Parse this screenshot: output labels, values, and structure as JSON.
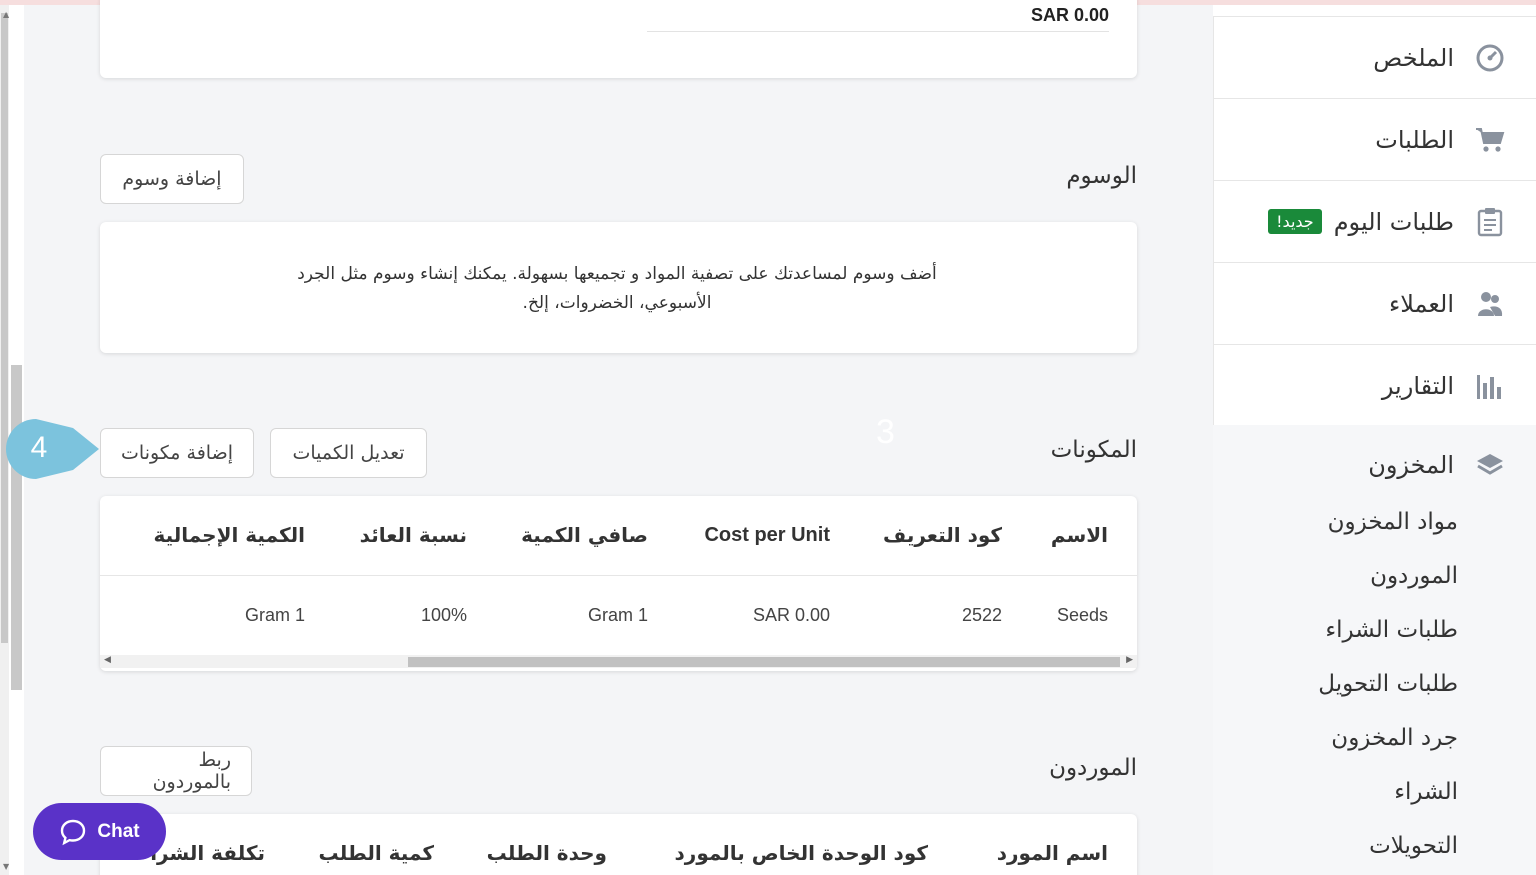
{
  "top_card": {
    "amount": "SAR 0.00"
  },
  "tags": {
    "title": "الوسوم",
    "add_button": "إضافة وسوم",
    "hint_line1": "أضف وسوم لمساعدتك على تصفية المواد و تجميعها بسهولة. يمكنك إنشاء وسوم مثل الجرد",
    "hint_line2": "الأسبوعي، الخضروات، إلخ."
  },
  "ingredients": {
    "title": "المكونات",
    "add_button": "إضافة مكونات",
    "edit_button": "تعديل الكميات",
    "faint_marker": "3",
    "columns": [
      "الاسم",
      "كود التعريف",
      "Cost per Unit",
      "صافي الكمية",
      "نسبة العائد",
      "الكمية الإجمالية"
    ],
    "rows": [
      [
        "Seeds",
        "2522",
        "SAR 0.00",
        "1 Gram",
        "100%",
        "1 Gram"
      ]
    ]
  },
  "suppliers": {
    "title": "الموردون",
    "link_button": "ربط بالموردون",
    "columns": [
      "اسم المورد",
      "كود الوحدة الخاص بالمورد",
      "وحدة الطلب",
      "كمية الطلب",
      "تكلفة الشراء"
    ]
  },
  "callout": {
    "number": "4",
    "color": "#7cc3dd"
  },
  "chat": {
    "label": "Chat",
    "color": "#5a32c8"
  },
  "sidebar": {
    "items": [
      {
        "label": "الملخص",
        "icon": "gauge-icon"
      },
      {
        "label": "الطلبات",
        "icon": "cart-icon"
      },
      {
        "label": "طلبات اليوم",
        "icon": "clipboard-icon",
        "badge": "جديد!"
      },
      {
        "label": "العملاء",
        "icon": "users-icon"
      },
      {
        "label": "التقارير",
        "icon": "bar-chart-icon"
      }
    ],
    "inventory": {
      "label": "المخزون",
      "icon": "layers-icon",
      "subitems": [
        "مواد المخزون",
        "الموردون",
        "طلبات الشراء",
        "طلبات التحويل",
        "جرد المخزون",
        "الشراء",
        "التحويلات"
      ]
    }
  }
}
